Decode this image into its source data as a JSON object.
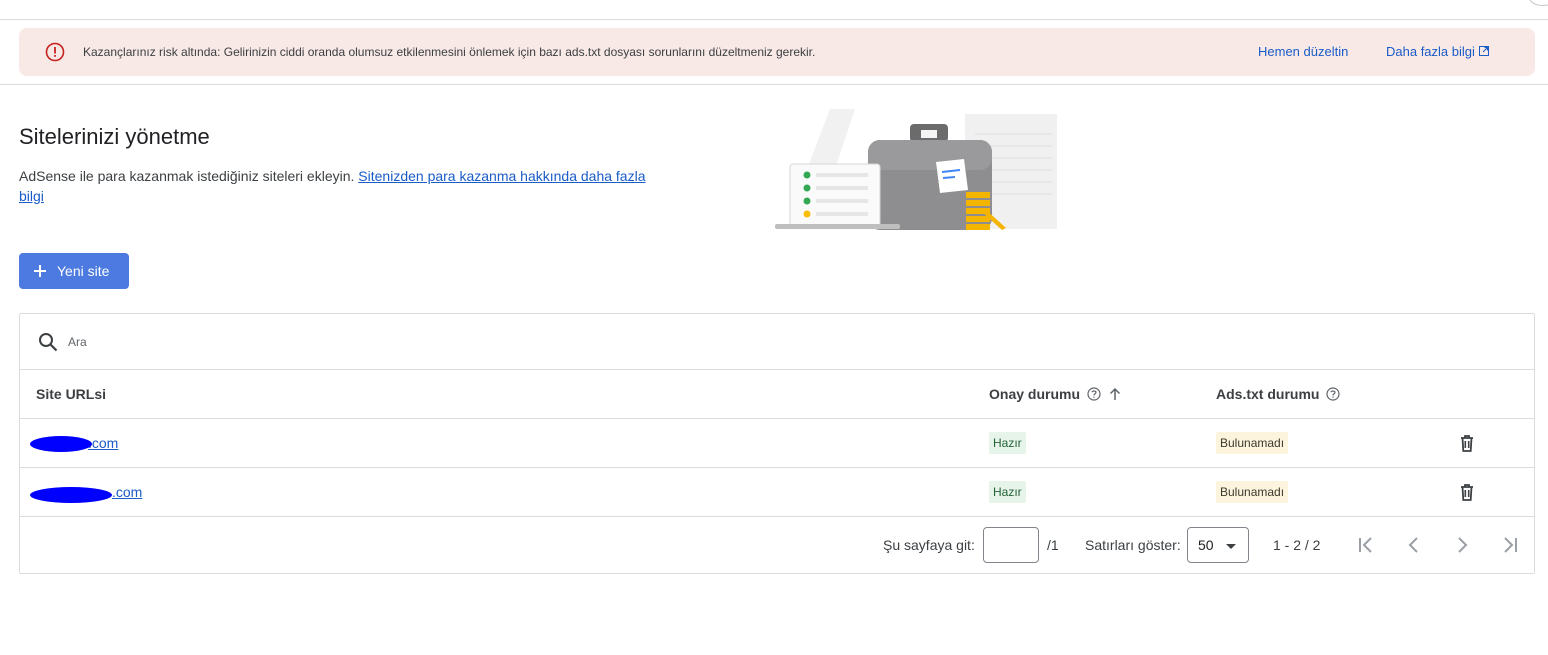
{
  "alert": {
    "message": "Kazançlarınız risk altında: Gelirinizin ciddi oranda olumsuz etkilenmesini önlemek için bazı ads.txt dosyası sorunlarını düzeltmeniz gerekir.",
    "fix_label": "Hemen düzeltin",
    "more_label": "Daha fazla bilgi",
    "color": "#f8e8e6",
    "icon_color": "#c5221f",
    "icon": "error-circle-icon"
  },
  "page": {
    "title": "Sitelerinizi yönetme",
    "description": "AdSense ile para kazanmak istediğiniz siteleri ekleyin.",
    "description_link": "Sitenizden para kazanma hakkında daha fazla bilgi"
  },
  "new_site_button": {
    "label": "Yeni site",
    "color": "#4c7ae0"
  },
  "search": {
    "placeholder": "Ara",
    "icon": "search-icon"
  },
  "table": {
    "columns": [
      {
        "label": "Site URLsi"
      },
      {
        "label": "Onay durumu"
      },
      {
        "label": "Ads.txt durumu"
      }
    ],
    "rows": [
      {
        "url_suffix": ".com",
        "approval": "Hazır",
        "ads_txt": "Bulunamadı"
      },
      {
        "url_suffix": ".com",
        "approval": "Hazır",
        "ads_txt": "Bulunamadı"
      }
    ]
  },
  "pagination": {
    "goto_label": "Şu sayfaya git:",
    "goto_value": "",
    "total_pages": "/1",
    "rows_label": "Satırları göster:",
    "rows_value": "50",
    "range": "1 - 2 / 2"
  }
}
